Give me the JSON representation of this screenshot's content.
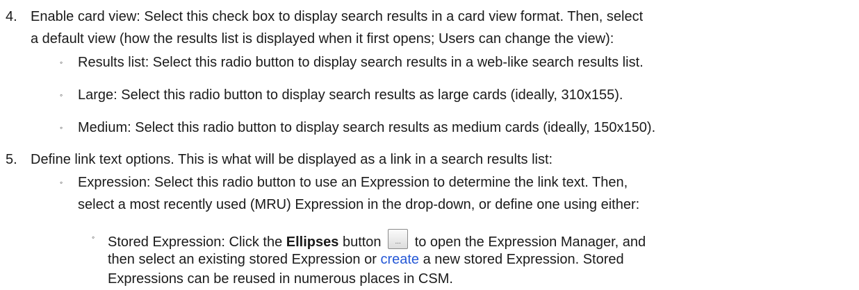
{
  "items": [
    {
      "number": "4.",
      "line1": "Enable card view: Select this check box to display search results in a card view format. Then, select",
      "line2": "a default view (how the results list is displayed when it first opens; Users can change the view):",
      "subitems": [
        "Results list: Select this radio button to display search results in a web-like search results list.",
        "Large: Select this radio button to display search results as large cards (ideally, 310x155).",
        "Medium: Select this radio button to display search results as medium cards (ideally, 150x150)."
      ]
    },
    {
      "number": "5.",
      "line1": "Define link text options. This is what will be displayed as a link in a search results list:",
      "sub": {
        "line1": "Expression: Select this radio button to use an Expression to determine the link text. Then,",
        "line2": "select a most recently used (MRU) Expression in the drop-down, or define one using either:",
        "nested": {
          "before_bold": "Stored Expression: Click the ",
          "bold": "Ellipses",
          "after_bold": " button",
          "button_glyph": "...",
          "after_button": "to open the Expression Manager, and",
          "line2_before_link": "then select an existing stored Expression or ",
          "link": "create",
          "line2_after_link": " a new stored Expression. Stored",
          "line3": "Expressions can be reused in numerous places in CSM."
        }
      }
    }
  ],
  "bullet_glyph": "◦",
  "colors": {
    "text": "#1a1a1a",
    "link": "#2457d6"
  }
}
